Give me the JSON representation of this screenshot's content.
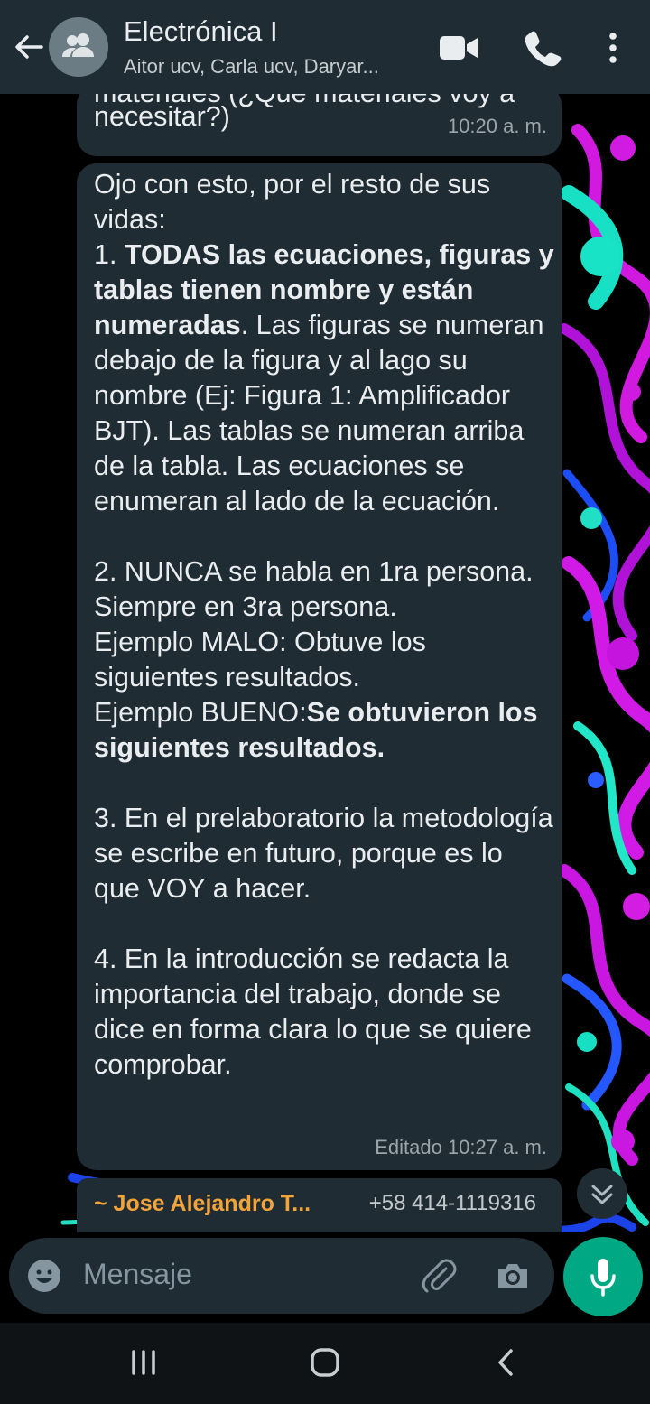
{
  "header": {
    "title": "Electrónica I",
    "subtitle": "Aitor ucv, Carla ucv, Daryar...",
    "icons": [
      "back-arrow-icon",
      "group-avatar-icon",
      "video-call-icon",
      "voice-call-icon",
      "more-options-icon"
    ]
  },
  "messages": {
    "first": {
      "partial_line": "materiales (¿Qué materiales voy a",
      "last_line": "necesitar?)",
      "time": "10:20 a. m."
    },
    "second": {
      "p1": "Ojo con esto, por el resto de sus vidas:",
      "p2_num": "1. ",
      "p2_bold": "TODAS las ecuaciones, figuras y tablas tienen nombre y están numeradas",
      "p2_rest": ". Las figuras se numeran debajo de la figura y al lago su nombre (Ej: Figura 1: Amplificador BJT). Las tablas se numeran arriba de la tabla. Las ecuaciones se enumeran al lado de la ecuación.",
      "p3": "2. NUNCA se habla en 1ra persona. Siempre en 3ra persona.",
      "p3_bad": "Ejemplo MALO: Obtuve los siguientes resultados.",
      "p3_good_label": "Ejemplo BUENO:",
      "p3_good_bold": "Se obtuvieron los siguientes resultados.",
      "p4": "3. En el prelaboratorio la metodología se escribe en futuro, porque es lo que VOY a hacer.",
      "p5": "4. En la introducción se redacta la importancia del trabajo, donde se dice en forma clara lo que se quiere comprobar.",
      "time": "Editado 10:27 a. m."
    },
    "third": {
      "sender": "~ Jose Alejandro T...",
      "phone": "+58 414-1119316"
    }
  },
  "composer": {
    "placeholder": "Mensaje"
  },
  "colors": {
    "header_bg": "#1f2c34",
    "bubble_bg": "#202c33",
    "accent_green": "#00a884",
    "sender_orange": "#f2a33a"
  }
}
